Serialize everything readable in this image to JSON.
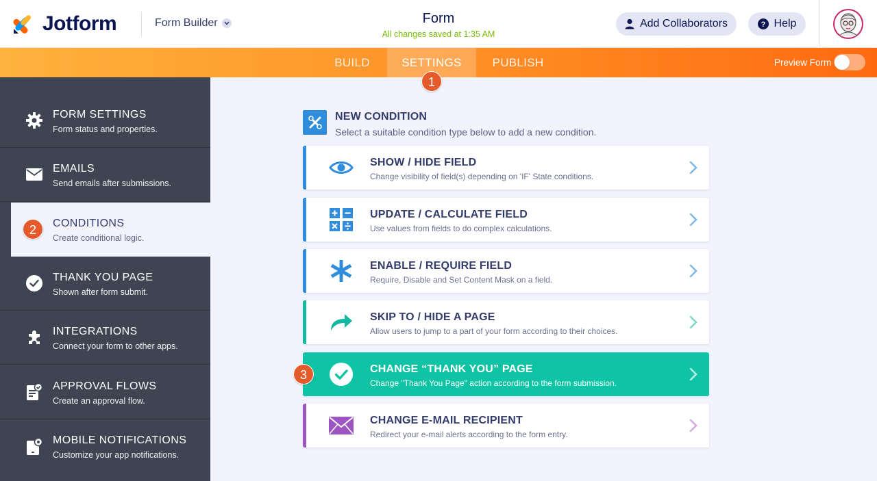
{
  "header": {
    "brand": "Jotform",
    "builder_label": "Form Builder",
    "form_title": "Form",
    "save_status": "All changes saved at 1:35 AM",
    "collaborators_label": "Add Collaborators",
    "help_label": "Help"
  },
  "tabs": {
    "build": "BUILD",
    "settings": "SETTINGS",
    "publish": "PUBLISH",
    "preview_label": "Preview Form",
    "preview_on": false
  },
  "steps": [
    "1",
    "2",
    "3"
  ],
  "sidebar": {
    "items": [
      {
        "title": "FORM SETTINGS",
        "desc": "Form status and properties.",
        "icon": "gear-icon"
      },
      {
        "title": "EMAILS",
        "desc": "Send emails after submissions.",
        "icon": "envelope-icon"
      },
      {
        "title": "CONDITIONS",
        "desc": "Create conditional logic.",
        "icon": "conditions-icon"
      },
      {
        "title": "THANK YOU PAGE",
        "desc": "Shown after form submit.",
        "icon": "check-circle-icon"
      },
      {
        "title": "INTEGRATIONS",
        "desc": "Connect your form to other apps.",
        "icon": "puzzle-icon"
      },
      {
        "title": "APPROVAL FLOWS",
        "desc": "Create an approval flow.",
        "icon": "approval-icon"
      },
      {
        "title": "MOBILE NOTIFICATIONS",
        "desc": "Customize your app notifications.",
        "icon": "mobile-notification-icon"
      }
    ],
    "active_index": 2
  },
  "main": {
    "header_title": "NEW CONDITION",
    "header_subtitle": "Select a suitable condition type below to add a new condition.",
    "conditions": [
      {
        "title": "SHOW / HIDE FIELD",
        "desc": "Change visibility of field(s) depending on 'IF' State conditions.",
        "icon": "eye-icon"
      },
      {
        "title": "UPDATE / CALCULATE FIELD",
        "desc": "Use values from fields to do complex calculations.",
        "icon": "calculator-icon"
      },
      {
        "title": "ENABLE / REQUIRE FIELD",
        "desc": "Require, Disable and Set Content Mask on a field.",
        "icon": "asterisk-icon"
      },
      {
        "title": "SKIP TO / HIDE A PAGE",
        "desc": "Allow users to jump to a part of your form according to their choices.",
        "icon": "skip-arrow-icon"
      },
      {
        "title": "CHANGE “THANK YOU” PAGE",
        "desc": "Change \"Thank You Page\" action according to the form submission.",
        "icon": "check-circle-icon"
      },
      {
        "title": "CHANGE E-MAIL RECIPIENT",
        "desc": "Redirect your e-mail alerts according to the form entry.",
        "icon": "envelope-icon"
      }
    ],
    "selected_index": 4
  },
  "colors": {
    "orange_start": "#ffb23f",
    "orange_end": "#ff6a11",
    "sidebar_bg": "#3e4452",
    "accent_blue": "#2f8ddb",
    "accent_green": "#0fc4a4",
    "accent_purple": "#9c55c1",
    "step_badge": "#e55a2b"
  }
}
